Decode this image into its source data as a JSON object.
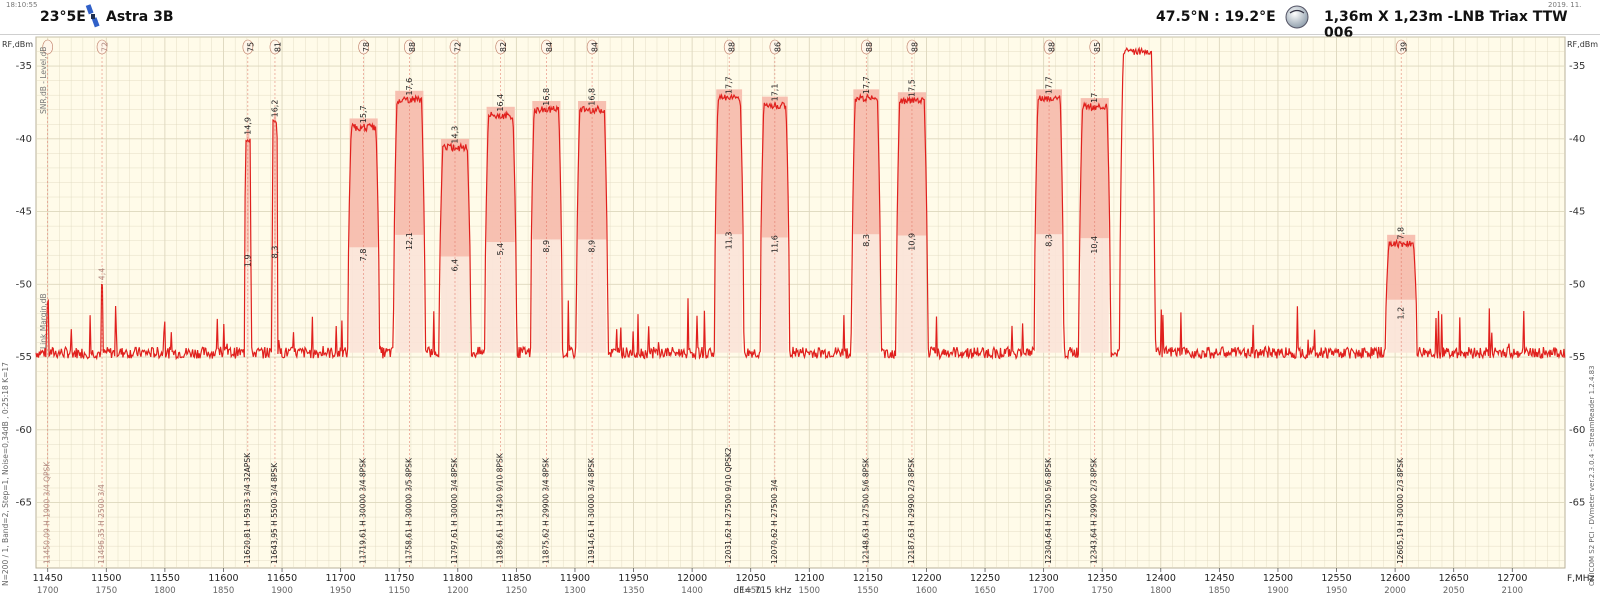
{
  "header": {
    "time_stamp": "18:10:55",
    "date_stamp": "2019. 11.",
    "sat_position": "23°5E",
    "sat_name": "Astra 3B",
    "coords": "47.5°N : 19.2°E",
    "dish": "1,36m X 1,23m -LNB Triax TTW 006"
  },
  "colors": {
    "trace": "#e0201d",
    "fill": "#f5b3a3",
    "band": "#fbe3d8",
    "bg": "#fffbe9",
    "grid": "#ddd7bd"
  },
  "chart_data": {
    "type": "line",
    "title": "",
    "ylabel": "RF,dBm",
    "xlabel": "F,MHz",
    "xlim": [
      11440,
      12745
    ],
    "ylim": [
      -69.5,
      -33
    ],
    "y_ticks": [
      -35,
      -40,
      -45,
      -50,
      -55,
      -60,
      -65
    ],
    "x_ticks": [
      11450,
      11500,
      11550,
      11600,
      11650,
      11700,
      11750,
      11800,
      11850,
      11900,
      11950,
      12000,
      12050,
      12100,
      12150,
      12200,
      12250,
      12300,
      12350,
      12400,
      12450,
      12500,
      12550,
      12600,
      12650,
      12700
    ],
    "x_ticks_if": [
      1700,
      1750,
      1800,
      1850,
      1900,
      1950,
      1150,
      1200,
      1250,
      1300,
      1350,
      1400,
      1450,
      1500,
      1550,
      1600,
      1650,
      1700,
      1750,
      1800,
      1850,
      1900,
      1950,
      2000,
      2050,
      2100
    ],
    "dF_label": "dF= 715 kHz",
    "x_axis_end_label": "F,MHz",
    "left_axis_title": "RF,dBm",
    "right_axis_title": "RF,dBm",
    "left_top_label": "SNR,dB - Level,dB",
    "left_mid_label": "Link Margin,dB",
    "left_bottom_label": "N=200 / 1, Band=2, Step=1, Noise=0,34dB , 0:25:18  K=17",
    "right_vertical_label": "OMICOM S2 PCI - DVmeter ver.2.3.0.4 - StreamReader 1.2.4.83",
    "noise_floor": -54.7,
    "transponders": [
      {
        "freq": 11450,
        "label": "11450,09  H  1900  3/4  QPSK",
        "level": -51.1,
        "bw": 2,
        "snr": "",
        "margin": "",
        "mer": "",
        "faded": true
      },
      {
        "freq": 11496.35,
        "label": "11496,35  H   2500  3/4",
        "level": -50.0,
        "bw": 2,
        "snr": "4,4",
        "margin": "",
        "mer": "72",
        "faded": true
      },
      {
        "freq": 11620.81,
        "label": "11620,81  H   5933  3/4  32APSK",
        "level": -40.0,
        "bw": 5.5,
        "snr": "14,9",
        "margin": "1,9",
        "mer": "75",
        "faded": false
      },
      {
        "freq": 11643.95,
        "label": "11643,95  H   5500  3/4  8PSK",
        "level": -38.8,
        "bw": 5,
        "snr": "16,2",
        "margin": "8,3",
        "mer": "81",
        "faded": false
      },
      {
        "freq": 11719.61,
        "label": "11719,61  H   30000  3/4  8PSK",
        "level": -39.2,
        "bw": 27,
        "snr": "15,7",
        "margin": "7,8",
        "mer": "78",
        "faded": false
      },
      {
        "freq": 11758.61,
        "label": "11758,61  H   30000  3/5  8PSK",
        "level": -37.3,
        "bw": 27,
        "snr": "17,6",
        "margin": "12,1",
        "mer": "88",
        "faded": false
      },
      {
        "freq": 11797.61,
        "label": "11797,61  H   30000  3/4  8PSK",
        "level": -40.6,
        "bw": 27,
        "snr": "14,3",
        "margin": "6,4",
        "mer": "72",
        "faded": false
      },
      {
        "freq": 11836.61,
        "label": "11836,61  H   31430  9/10  8PSK",
        "level": -38.4,
        "bw": 27,
        "snr": "16,4",
        "margin": "5,4",
        "mer": "82",
        "faded": false
      },
      {
        "freq": 11875.62,
        "label": "11875,62  H   29900  3/4  8PSK",
        "level": -38.0,
        "bw": 27,
        "snr": "16,8",
        "margin": "8,9",
        "mer": "84",
        "faded": false
      },
      {
        "freq": 11914.61,
        "label": "11914,61  H   30000  3/4  8PSK",
        "level": -38.0,
        "bw": 27,
        "snr": "16,8",
        "margin": "8,9",
        "mer": "84",
        "faded": false
      },
      {
        "freq": 12031.62,
        "label": "12031,62  H   27500  9/10  QPSK2",
        "level": -37.2,
        "bw": 25,
        "snr": "17,7",
        "margin": "11,3",
        "mer": "88",
        "faded": false
      },
      {
        "freq": 12070.62,
        "label": "12070,62  H   27500  3/4",
        "level": -37.7,
        "bw": 25,
        "snr": "17,1",
        "margin": "11,6",
        "mer": "86",
        "faded": false
      },
      {
        "freq": 12148.63,
        "label": "12148,63  H   27500  5/6  8PSK",
        "level": -37.2,
        "bw": 25,
        "snr": "17,7",
        "margin": "8,3",
        "mer": "88",
        "faded": false
      },
      {
        "freq": 12187.63,
        "label": "12187,63  H   29900  2/3  8PSK",
        "level": -37.4,
        "bw": 27,
        "snr": "17,5",
        "margin": "10,9",
        "mer": "88",
        "faded": false
      },
      {
        "freq": 12304.64,
        "label": "12304,64  H   27500  5/6  8PSK",
        "level": -37.2,
        "bw": 25,
        "snr": "17,7",
        "margin": "8,3",
        "mer": "88",
        "faded": false
      },
      {
        "freq": 12343.64,
        "label": "12343,64  H   29900  2/3  8PSK",
        "level": -37.8,
        "bw": 27,
        "snr": "17",
        "margin": "10,4",
        "mer": "85",
        "faded": false
      },
      {
        "freq": 12605.19,
        "label": "12605,19  H   30000  2/3  8PSK",
        "level": -47.2,
        "bw": 27,
        "snr": "7,8",
        "margin": "1,2",
        "mer": "39",
        "faded": false
      }
    ],
    "unlabeled_carrier": {
      "f_start": 12365,
      "f_end": 12395,
      "level": -34.0
    }
  }
}
